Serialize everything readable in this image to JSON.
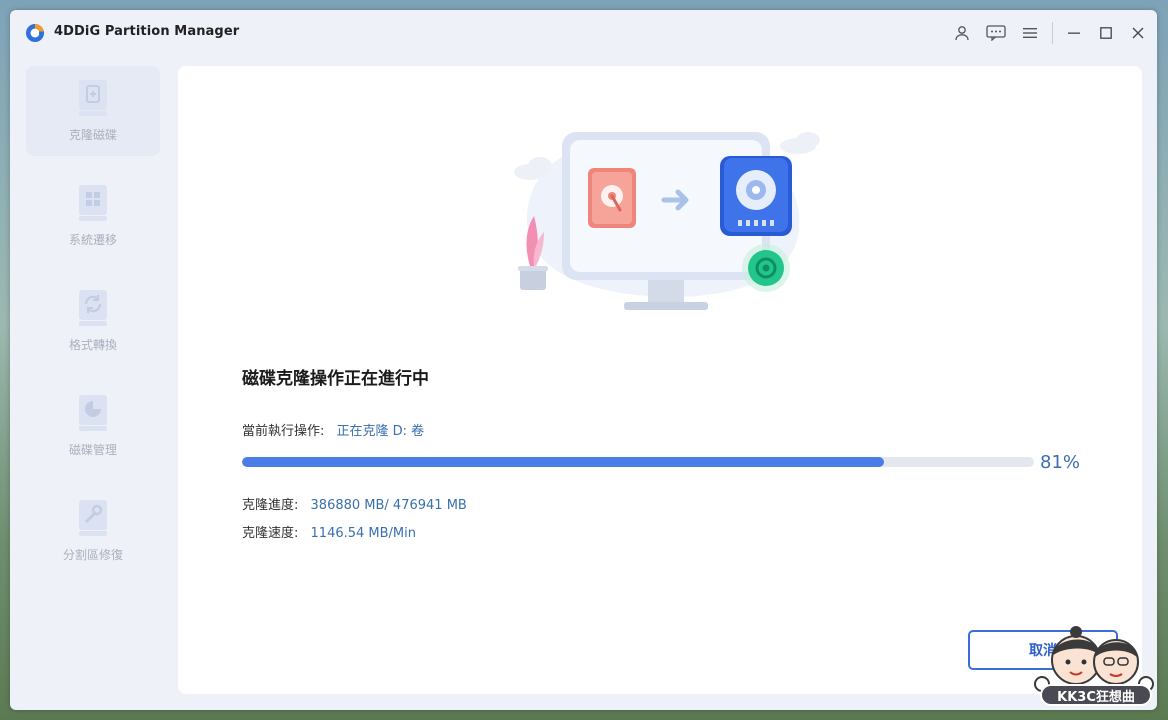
{
  "window": {
    "title": "4DDiG Partition Manager"
  },
  "titlebar": {
    "icons": [
      "user-icon",
      "feedback-icon",
      "menu-icon",
      "minimize-icon",
      "maximize-icon",
      "close-icon"
    ]
  },
  "sidebar": {
    "items": [
      {
        "label": "克隆磁碟",
        "icon": "clone-disk-icon",
        "active": true
      },
      {
        "label": "系統遷移",
        "icon": "system-migration-icon",
        "active": false
      },
      {
        "label": "格式轉換",
        "icon": "format-convert-icon",
        "active": false
      },
      {
        "label": "磁碟管理",
        "icon": "disk-management-icon",
        "active": false
      },
      {
        "label": "分割區修復",
        "icon": "partition-repair-icon",
        "active": false
      }
    ]
  },
  "main": {
    "heading": "磁碟克隆操作正在進行中",
    "current_op_label": "當前執行操作:",
    "current_op_value": "正在克隆 D: 卷",
    "progress_percent_text": "81%",
    "progress_fraction": 0.81,
    "clone_progress_label": "克隆進度:",
    "clone_progress_value": "386880 MB/ 476941 MB",
    "clone_speed_label": "克隆速度:",
    "clone_speed_value": "1146.54 MB/Min",
    "cancel_label": "取消"
  },
  "watermark": {
    "text": "KK3C狂想曲"
  },
  "colors": {
    "accent": "#4a7ee6",
    "value_text": "#3a6fb0",
    "sidebar_label": "#aab0bd",
    "window_bg": "#eef1f8"
  }
}
